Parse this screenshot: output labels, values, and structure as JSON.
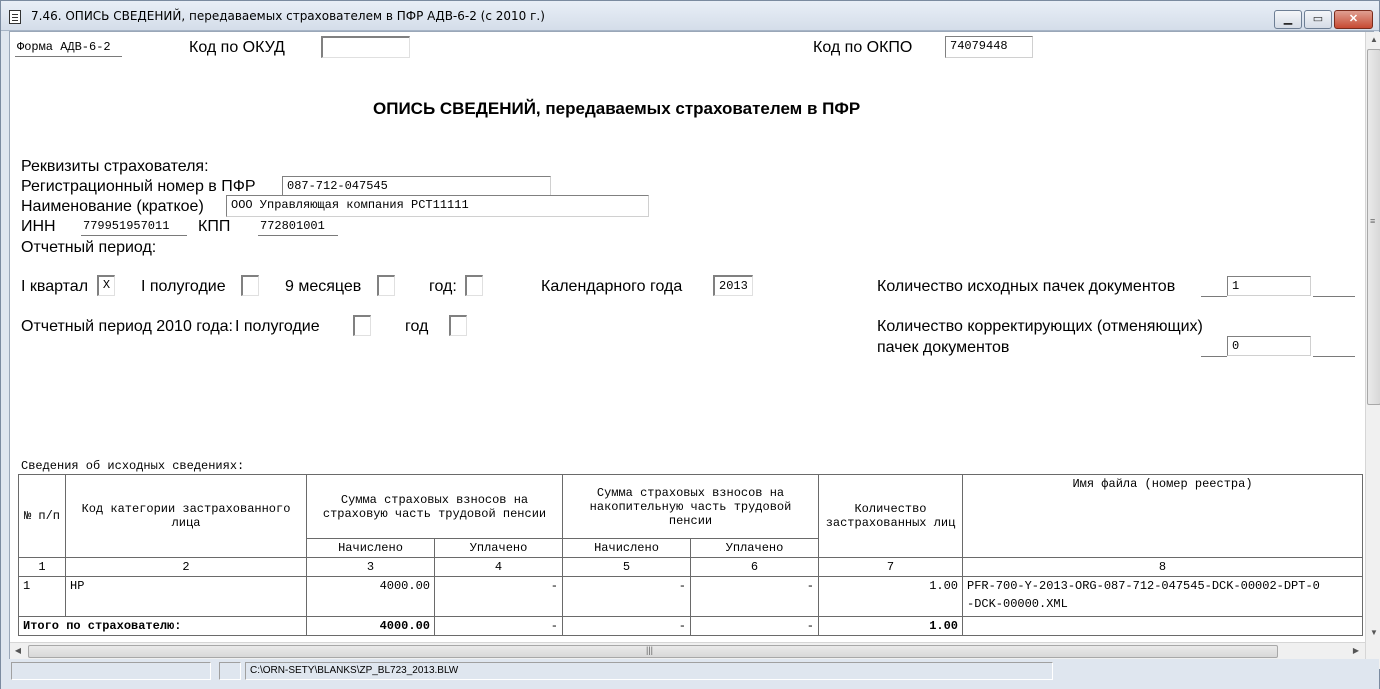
{
  "window": {
    "title": "7.46. ОПИСЬ СВЕДЕНИЙ, передаваемых страхователем в ПФР АДВ-6-2 (с 2010 г.)",
    "min_symbol": "▁",
    "max_symbol": "▭",
    "close_symbol": "✕"
  },
  "form": {
    "form_name": "Форма АДВ-6-2",
    "okud_label": "Код по ОКУД",
    "okud_value": "",
    "okpo_label": "Код по ОКПО",
    "okpo_value": "74079448",
    "heading": "ОПИСЬ СВЕДЕНИЙ, передаваемых страхователем в ПФР",
    "requisites_label": "Реквизиты страхователя:",
    "reg_number_label": "Регистрационный номер в ПФР",
    "reg_number_value": "087-712-047545",
    "name_label": "Наименование (краткое)",
    "name_value": "ООО Управляющая компания РСТ11111",
    "inn_label": "ИНН",
    "inn_value": "779951957011",
    "kpp_label": "КПП",
    "kpp_value": "772801001",
    "period_label": "Отчетный период:",
    "q1_label": "I квартал",
    "q1_value": "X",
    "half_label": "I полугодие",
    "half_value": "",
    "nine_label": "9 месяцев",
    "nine_value": "",
    "year_label": "год:",
    "year_value": "",
    "calendar_year_label": "Календарного года",
    "calendar_year_value": "2013",
    "source_packs_label": "Количество исходных пачек документов",
    "source_packs_value": "1",
    "period2010_label": "Отчетный период 2010 года:",
    "period2010_half_label": "I полугодие",
    "period2010_half_value": "",
    "period2010_year_label": "год",
    "period2010_year_value": "",
    "corr_packs_label_1": "Количество корректирующих (отменяющих)",
    "corr_packs_label_2": "пачек документов",
    "corr_packs_value": "0"
  },
  "table": {
    "caption": "Сведения об исходных сведениях:",
    "h_num": "№ п/п",
    "h_category": "Код категории застрахованного лица",
    "h_insurance": "Сумма страховых взносов на страховую часть трудовой пенсии",
    "h_funded": "Сумма страховых взносов на накопительную часть трудовой пенсии",
    "h_count": "Количество застрахованных лиц",
    "h_file": "Имя файла (номер реестра)",
    "h_accrued": "Начислено",
    "h_paid": "Уплачено",
    "col_numbers": [
      "1",
      "2",
      "3",
      "4",
      "5",
      "6",
      "7",
      "8"
    ],
    "rows": [
      {
        "num": "1",
        "category": "НР",
        "ins_accrued": "4000.00",
        "ins_paid": "-",
        "fund_accrued": "-",
        "fund_paid": "-",
        "count": "1.00",
        "file_line1": "PFR-700-Y-2013-ORG-087-712-047545-DCK-00002-DPT-0",
        "file_line2": "-DCK-00000.XML"
      }
    ],
    "total": {
      "label": "Итого по страхователю:",
      "ins_accrued": "4000.00",
      "ins_paid": "-",
      "fund_accrued": "-",
      "fund_paid": "-",
      "count": "1.00"
    }
  },
  "scroll": {
    "up": "▲",
    "down": "▼",
    "left": "◀",
    "right": "▶",
    "grip": "≡",
    "hgrip": "|||"
  },
  "status": {
    "panel1": "",
    "panel2": "",
    "path": "C:\\ORN-SETY\\BLANKS\\ZP_BL723_2013.BLW"
  }
}
